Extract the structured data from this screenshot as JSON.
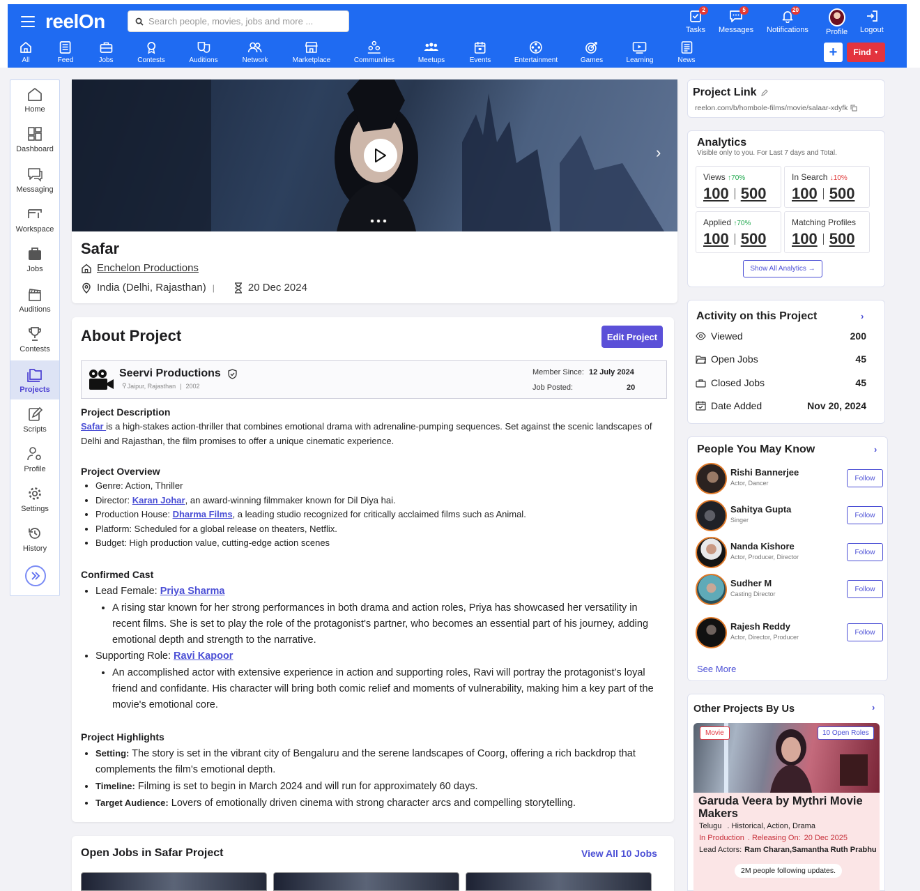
{
  "header": {
    "logo": "reelOn",
    "search_placeholder": "Search people, movies, jobs and more ...",
    "tasks": {
      "label": "Tasks",
      "badge": "2"
    },
    "messages": {
      "label": "Messages",
      "badge": "5"
    },
    "notifications": {
      "label": "Notifications",
      "badge": "20"
    },
    "profile": "Profile",
    "logout": "Logout",
    "nav": [
      "All",
      "Feed",
      "Jobs",
      "Contests",
      "Auditions",
      "Network",
      "Marketplace",
      "Communities",
      "Meetups",
      "Events",
      "Entertainment",
      "Games",
      "Learning",
      "News"
    ],
    "add_button": "+",
    "find_button": "Find"
  },
  "sidebar": [
    "Home",
    "Dashboard",
    "Messaging",
    "Workspace",
    "Jobs",
    "Auditions",
    "Contests",
    "Projects",
    "Scripts",
    "Profile",
    "Settings",
    "History"
  ],
  "project": {
    "title": "Safar",
    "company": "Enchelon Productions",
    "location": "India (Delhi, Rajasthan)",
    "separator": "|",
    "date": "20 Dec 2024"
  },
  "about": {
    "heading": "About Project",
    "edit_button": "Edit Project",
    "producer": {
      "name": "Seervi Productions",
      "location": "Jaipur, Rajasthan",
      "sep": "|",
      "year": "2002",
      "member_since_label": "Member Since:",
      "member_since": "12 July 2024",
      "jobs_posted_label": "Job Posted:",
      "jobs_posted": "20"
    },
    "description_heading": "Project Description",
    "description_link": "Safar ",
    "description_text": "is a high-stakes action-thriller that combines emotional drama with adrenaline-pumping sequences. Set against the scenic landscapes of Delhi and Rajasthan, the film promises to offer a unique cinematic experience.",
    "overview_heading": "Project Overview",
    "overview": {
      "genre": "Genre: Action, Thriller",
      "director_pre": "Director: ",
      "director_link": "Karan Johar",
      "director_post": ", an award-winning filmmaker known for Dil Diya hai.",
      "house_pre": "Production House: ",
      "house_link": "Dharma Films",
      "house_post": ", a leading studio recognized for critically acclaimed films such as Animal.",
      "platform": "Platform: Scheduled for a global release on theaters, Netflix.",
      "budget": "Budget: High production value, cutting-edge action scenes"
    },
    "cast_heading": "Confirmed Cast",
    "cast": [
      {
        "role": "Lead Female: ",
        "name": "Priya Sharma",
        "desc": "A rising star known for her strong performances in both drama and action roles, Priya has showcased her versatility in recent films. She is set to play the role of the protagonist's partner, who becomes an essential part of his journey, adding emotional depth and strength to the narrative."
      },
      {
        "role": "Supporting Role: ",
        "name": "Ravi Kapoor",
        "desc": "An accomplished actor with extensive experience in action and supporting roles, Ravi will portray the protagonist’s loyal friend and confidante. His character will bring both comic relief and moments of vulnerability, making him a key part of the movie's emotional core."
      }
    ],
    "highlights_heading": "Project Highlights",
    "highlights": [
      {
        "label": "Setting:",
        "text": " The story is set in the vibrant city of Bengaluru and the serene landscapes of Coorg, offering a rich backdrop that complements the film's emotional depth."
      },
      {
        "label": "Timeline:",
        "text": " Filming is set to begin in March 2024 and will run for approximately 60 days."
      },
      {
        "label": "Target Audience:",
        "text": " Lovers of emotionally driven cinema with strong character arcs and compelling storytelling."
      }
    ]
  },
  "open_jobs": {
    "heading": "Open Jobs in Safar Project",
    "view_all": "View All 10 Jobs"
  },
  "project_link": {
    "heading": "Project Link",
    "url": "reelon.com/b/hombole-films/movie/salaar-xdyfk"
  },
  "analytics": {
    "heading": "Analytics",
    "sub": "Visible only to you. For Last 7 days and Total.",
    "stats": [
      {
        "label": "Views",
        "change": "↑70%",
        "dir": "up",
        "week": "100",
        "total": "500"
      },
      {
        "label": "In Search",
        "change": "↓10%",
        "dir": "down",
        "week": "100",
        "total": "500"
      },
      {
        "label": "Applied",
        "change": "↑70%",
        "dir": "up",
        "week": "100",
        "total": "500"
      },
      {
        "label": "Matching Profiles",
        "change": "",
        "dir": "",
        "week": "100",
        "total": "500"
      }
    ],
    "show_all": "Show All Analytics →"
  },
  "activity": {
    "heading": "Activity on this Project",
    "items": [
      {
        "label": "Viewed",
        "value": "200"
      },
      {
        "label": "Open Jobs",
        "value": "45"
      },
      {
        "label": "Closed Jobs",
        "value": "45"
      },
      {
        "label": "Date Added",
        "value": "Nov 20, 2024"
      }
    ]
  },
  "people": {
    "heading": "People You May Know",
    "follow": "Follow",
    "see_more": "See More",
    "list": [
      {
        "name": "Rishi Bannerjee",
        "role": "Actor, Dancer"
      },
      {
        "name": "Sahitya Gupta",
        "role": "Singer"
      },
      {
        "name": "Nanda Kishore",
        "role": "Actor, Producer, Director"
      },
      {
        "name": "Sudher M",
        "role": "Casting Director"
      },
      {
        "name": "Rajesh Reddy",
        "role": "Actor, Director, Producer"
      }
    ]
  },
  "other_projects": {
    "heading": "Other Projects By Us",
    "tag": "Movie",
    "roles": "10 Open Roles",
    "title": "Garuda Veera by Mythri Movie Makers",
    "lang": "Telugu",
    "genres": ". Historical, Action, Drama",
    "status": "In Production",
    "releasing_label": ". Releasing On:",
    "release_date": "20 Dec 2025",
    "lead_label": "Lead Actors:",
    "lead": "Ram Charan,Samantha Ruth Prabhu",
    "followers": "2M people following updates."
  },
  "colors": {
    "primary": "#1f6bf2",
    "accent": "#4b4fd5",
    "find": "#e3343e",
    "edit": "#5b50d8"
  }
}
